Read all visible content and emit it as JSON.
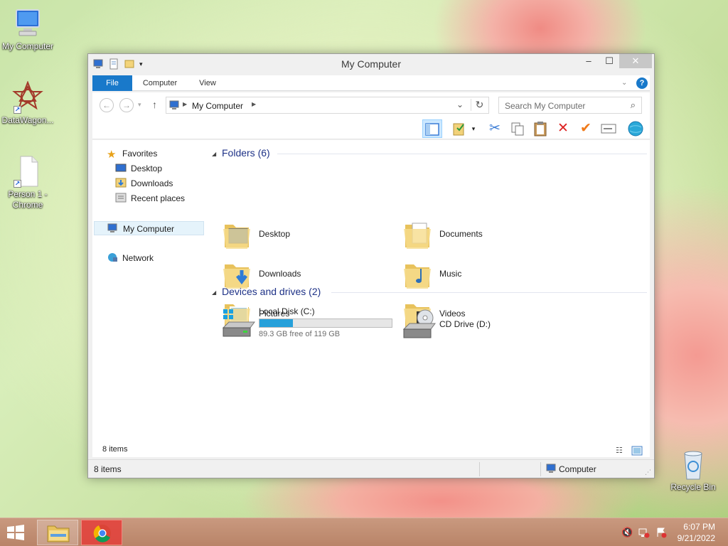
{
  "desktop": {
    "icons": [
      {
        "label": "My Computer",
        "icon": "my-computer-icon"
      },
      {
        "label": "DataWagon...",
        "icon": "datawagon-icon"
      },
      {
        "label": "Person 1 - Chrome",
        "icon": "chrome-profile-file-icon"
      },
      {
        "label": "Recycle Bin",
        "icon": "recycle-bin-icon"
      }
    ]
  },
  "window": {
    "title": "My Computer",
    "controls": {
      "minimize": "–",
      "maximize": "☐",
      "close": "✕"
    },
    "ribbon_tabs": [
      "File",
      "Computer",
      "View"
    ],
    "address": {
      "location": "My Computer"
    },
    "search": {
      "placeholder": "Search My Computer"
    },
    "toolbar": [
      "preview-pane-icon",
      "properties-icon",
      "cut-icon",
      "copy-icon",
      "paste-icon",
      "delete-icon",
      "check-icon",
      "rename-icon",
      "network-globe-icon"
    ],
    "nav_pane": {
      "favorites_label": "Favorites",
      "favorites": [
        "Desktop",
        "Downloads",
        "Recent places"
      ],
      "my_computer": "My Computer",
      "network": "Network"
    },
    "folders_group": "Folders (6)",
    "folders": [
      {
        "name": "Desktop",
        "icon": "desktop-folder-icon"
      },
      {
        "name": "Documents",
        "icon": "documents-folder-icon"
      },
      {
        "name": "Downloads",
        "icon": "downloads-folder-icon"
      },
      {
        "name": "Music",
        "icon": "music-folder-icon"
      },
      {
        "name": "Pictures",
        "icon": "pictures-folder-icon"
      },
      {
        "name": "Videos",
        "icon": "videos-folder-icon"
      }
    ],
    "drives_group": "Devices and drives (2)",
    "drives": [
      {
        "name": "Local Disk (C:)",
        "free_text": "89.3 GB free of 119 GB",
        "used_fraction": 0.25
      },
      {
        "name": "CD Drive (D:)"
      }
    ],
    "status_inner": "8 items",
    "status": {
      "items": "8 items",
      "location": "Computer"
    }
  },
  "taskbar": {
    "clock_time": "6:07 PM",
    "clock_date": "9/21/2022",
    "accent": "#1979ca"
  }
}
